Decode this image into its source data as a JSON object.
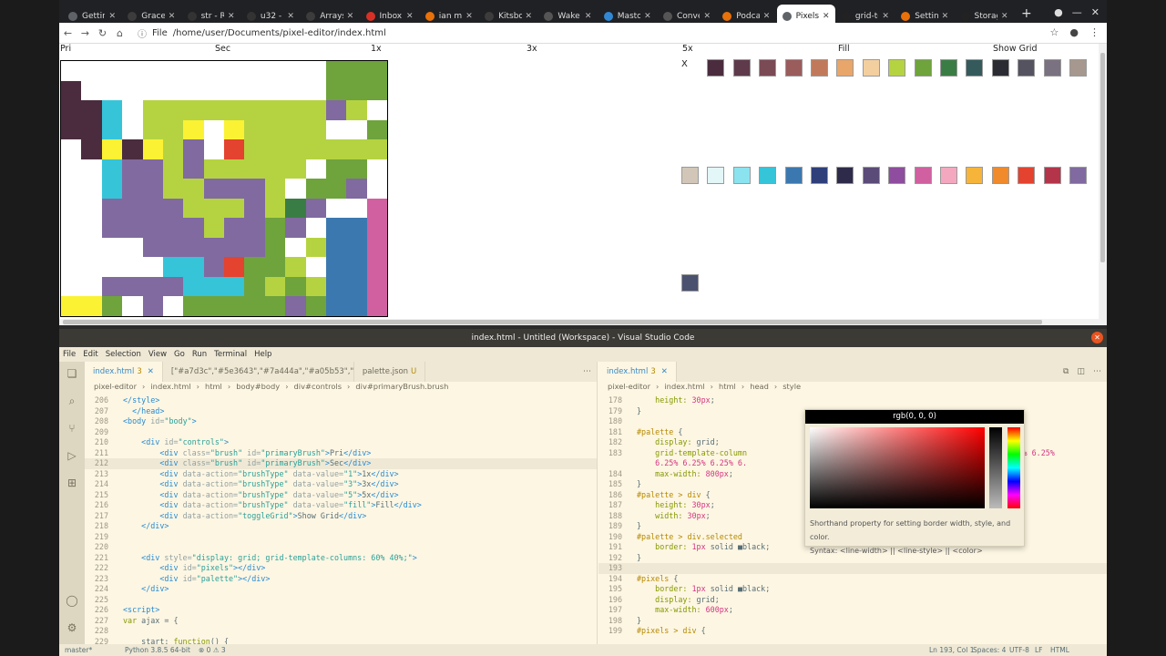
{
  "browser": {
    "tabs": [
      {
        "label": "Getting",
        "color": "#5f6368"
      },
      {
        "label": "Gracefu",
        "color": "#3c3c3c"
      },
      {
        "label": "str - Ru",
        "color": "#333"
      },
      {
        "label": "u32 - Ru",
        "color": "#333"
      },
      {
        "label": "Arrays a",
        "color": "#3c3c3c"
      },
      {
        "label": "Inbox (",
        "color": "#d93025"
      },
      {
        "label": "ian ma",
        "color": "#e8710a"
      },
      {
        "label": "Kitsbo",
        "color": "#3c3c3c"
      },
      {
        "label": "Wake P",
        "color": "#555"
      },
      {
        "label": "Mastod",
        "color": "#3088d4"
      },
      {
        "label": "Conver",
        "color": "#555"
      },
      {
        "label": "Podcas",
        "color": "#e8710a"
      },
      {
        "label": "Pixels",
        "color": "#5f6368",
        "active": true
      },
      {
        "label": "grid-te",
        "color": "#222"
      },
      {
        "label": "Setting",
        "color": "#e8710a"
      },
      {
        "label": "Storag",
        "color": "#222"
      }
    ],
    "file_label": "File",
    "url": "/home/user/Documents/pixel-editor/index.html",
    "new_tab": "+"
  },
  "pixel_app": {
    "controls": {
      "primary": "Pri",
      "secondary": "Sec",
      "b1": "1x",
      "b3": "3x",
      "b5": "5x",
      "fill": "Fill",
      "grid": "Show Grid"
    },
    "palette_x": "X",
    "pixels_grid": [
      "WWWWWWWWWWWWWGGG",
      "pWWWWWWWWWWWWGGG",
      "pPCWLLLLLLLLLVLW",
      "pPCWLLYWYLLLLWWG",
      "WPYPYLVWRLLLLLLL",
      "WWCVVLVLLLLLWGGW",
      "WWCVVLLVVVLWGGVW",
      "WWVVVVLLLVLDVWWM",
      "WWVVVVVLVVGVWBBM",
      "WWWWVVVVVVGWLBBM",
      "WWWWWCCVRGGLWBBM",
      "WWVVVVCCCGLGLBBM",
      "YYGWVWGGGGGVGBBM"
    ],
    "pixel_colors": {
      "W": "#ffffff",
      "G": "#6fa33c",
      "L": "#b5d341",
      "p": "#4a2c3e",
      "P": "#4a2c3e",
      "C": "#36c4d9",
      "V": "#806aa0",
      "Y": "#fbf233",
      "R": "#e4432f",
      "D": "#3a7d44",
      "B": "#3b78b0",
      "M": "#d060a0"
    },
    "palette_colors": [
      "#4a2c3e",
      "#5e3a4b",
      "#7a4a55",
      "#9b5c5c",
      "#c07a5b",
      "#e8a66a",
      "#f3cfa0",
      "#b5d341",
      "#6fa33c",
      "#3a7d44",
      "#355a5c",
      "#2b2b33",
      "#555360",
      "#7a7280",
      "#a6988e",
      "#d1c6b8",
      "#e3f6f8",
      "#8be3ef",
      "#36c4d9",
      "#3b78b0",
      "#2e3f7a",
      "#2e2b4a",
      "#5a4b78",
      "#8e4d9e",
      "#d060a0",
      "#f4a8c0",
      "#f6b43a",
      "#f08a2a",
      "#e4432f",
      "#b4354a",
      "#806aa0",
      "#4b5270"
    ]
  },
  "vscode": {
    "title": "index.html - Untitled (Workspace) - Visual Studio Code",
    "menu": [
      "File",
      "Edit",
      "Selection",
      "View",
      "Go",
      "Run",
      "Terminal",
      "Help"
    ],
    "left_tabs": [
      {
        "label": "index.html",
        "mod": "3",
        "active": true
      },
      {
        "label": "[\"#a7d3c\",\"#5e3643\",\"#7a444a\",\"#a05b53\",\"#b  Untitled-1",
        "mod": ""
      },
      {
        "label": "palette.json",
        "mod": "U"
      }
    ],
    "left_crumbs": [
      "pixel-editor",
      "›",
      "index.html",
      "›",
      "html",
      "›",
      "body#body",
      "›",
      "div#controls",
      "›",
      "div#primaryBrush.brush"
    ],
    "right_tabs": [
      {
        "label": "index.html",
        "mod": "3",
        "active": true
      }
    ],
    "right_crumbs": [
      "pixel-editor",
      "›",
      "index.html",
      "›",
      "html",
      "›",
      "head",
      "›",
      "style"
    ],
    "picker": {
      "title": "rgb(0, 0, 0)",
      "hint": "Shorthand property for setting border width, style, and color.",
      "syntax": "Syntax: <line-width> || <line-style> || <color>"
    },
    "status": {
      "branch": "master*",
      "python": "Python 3.8.5 64-bit",
      "errors": "⊗ 0 ⚠ 3",
      "position": "Ln 193, Col 1",
      "spaces": "Spaces: 4",
      "encoding": "UTF-8",
      "eol": "LF",
      "lang": "HTML"
    }
  }
}
